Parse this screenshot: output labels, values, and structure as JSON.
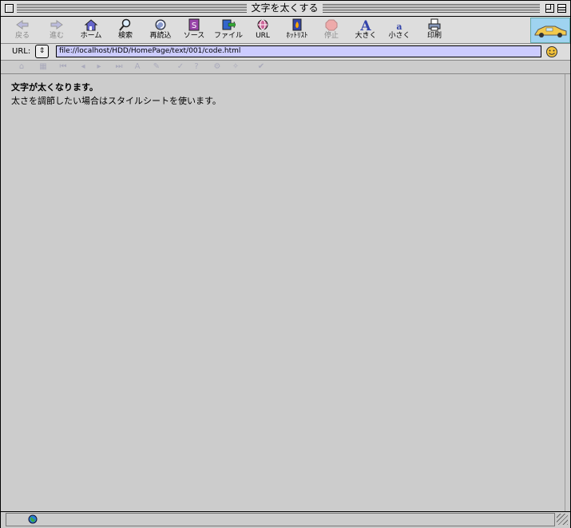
{
  "window": {
    "title": "文字を太くする"
  },
  "toolbar": {
    "buttons": [
      {
        "label": "戻る",
        "icon": "back-arrow-icon",
        "enabled": false
      },
      {
        "label": "進む",
        "icon": "forward-arrow-icon",
        "enabled": false
      },
      {
        "label": "ホーム",
        "icon": "home-icon",
        "enabled": true
      },
      {
        "label": "検索",
        "icon": "search-icon",
        "enabled": true
      },
      {
        "label": "再読込",
        "icon": "reload-icon",
        "enabled": true
      },
      {
        "label": "ソース",
        "icon": "source-icon",
        "enabled": true
      },
      {
        "label": "ファイル",
        "icon": "file-icon",
        "enabled": true
      },
      {
        "label": "URL",
        "icon": "url-globe-icon",
        "enabled": true
      },
      {
        "label": "ﾎｯﾄﾘｽﾄ",
        "icon": "hotlist-icon",
        "enabled": true
      },
      {
        "label": "停止",
        "icon": "stop-icon",
        "enabled": false
      },
      {
        "label": "大きく",
        "icon": "text-larger-icon",
        "enabled": true
      },
      {
        "label": "小さく",
        "icon": "text-smaller-icon",
        "enabled": true
      },
      {
        "label": "印刷",
        "icon": "print-icon",
        "enabled": true
      }
    ]
  },
  "urlbar": {
    "label": "URL:",
    "popup_glyph": "⇕",
    "value": "file://localhost/HDD/HomePage/text/001/code.html"
  },
  "content": {
    "heading": "文字が太くなります。",
    "body": "太さを調節したい場合はスタイルシートを使います。"
  },
  "colors": {
    "chrome": "#dddddd",
    "content_bg": "#cccccc",
    "url_field": "#ccccff"
  }
}
